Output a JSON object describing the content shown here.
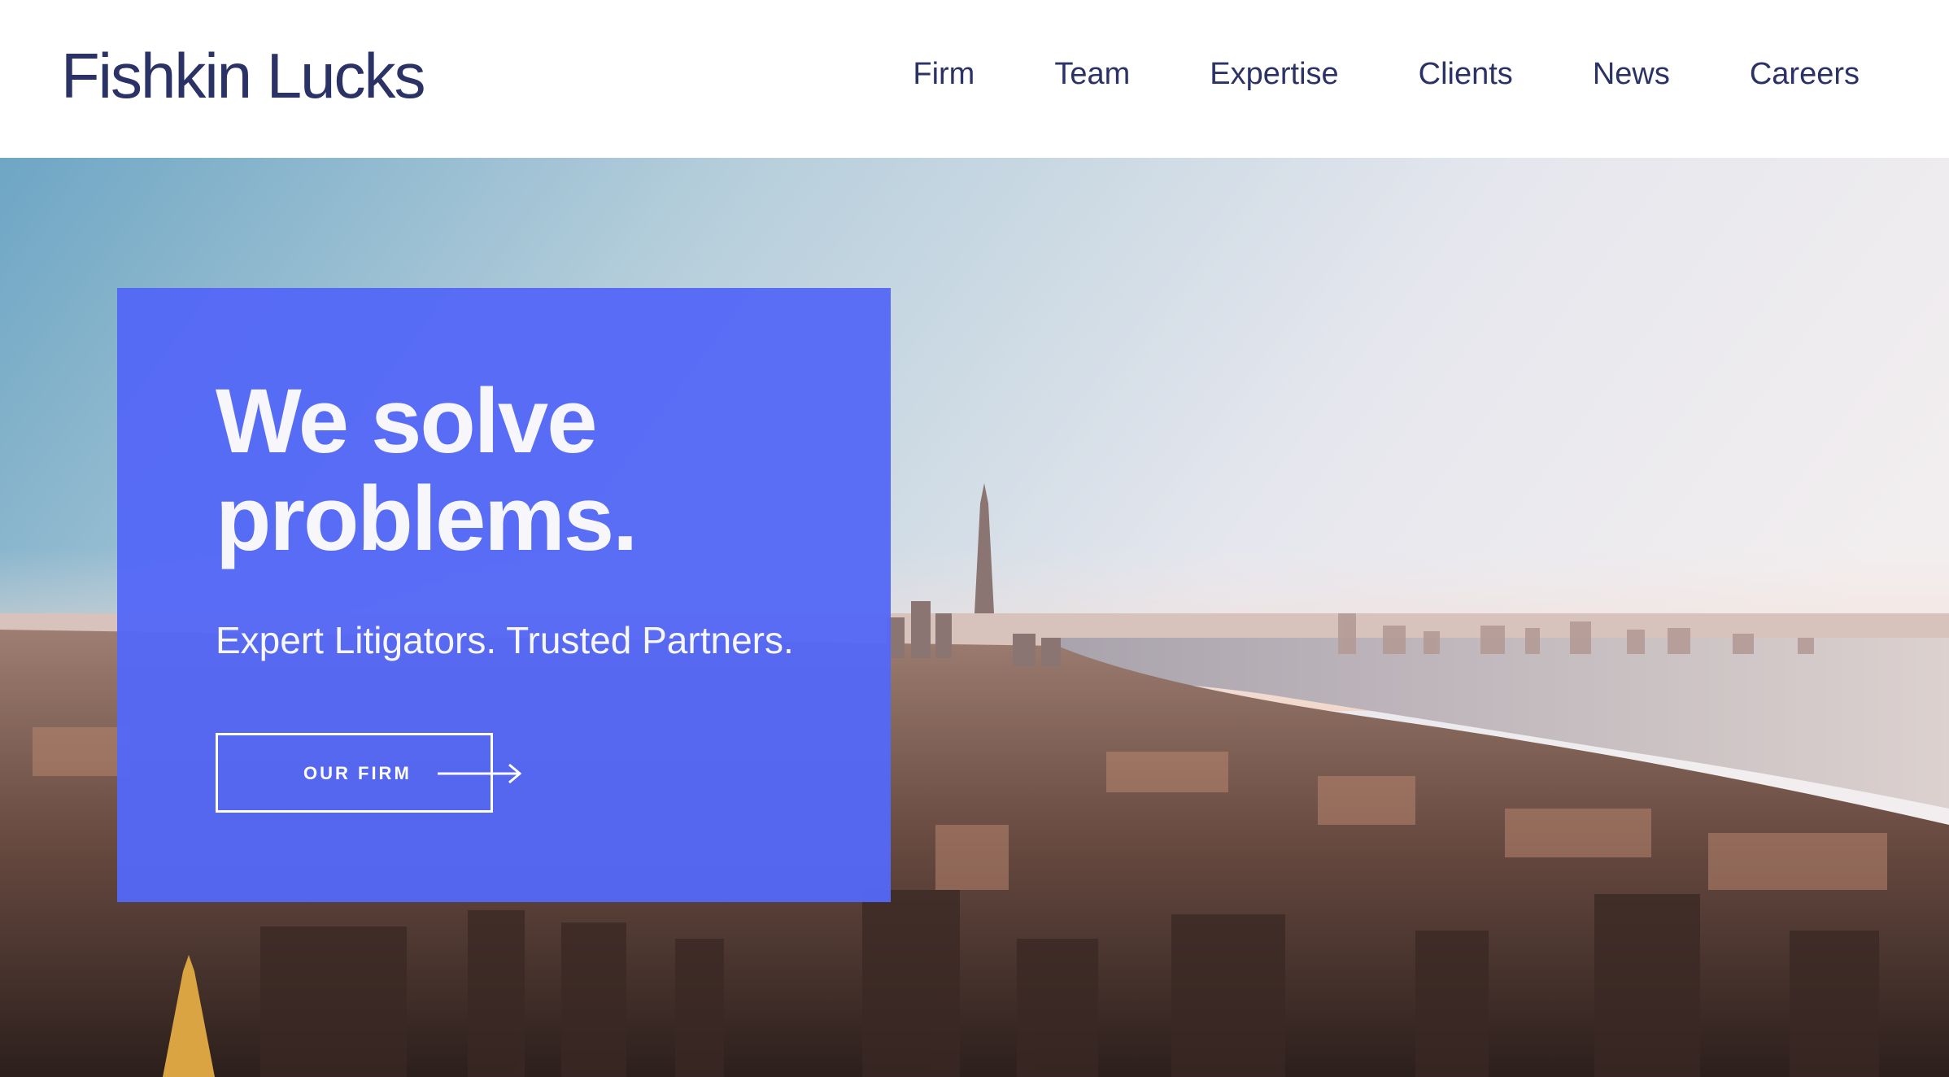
{
  "header": {
    "logo": "Fishkin Lucks",
    "nav": [
      {
        "label": "Firm"
      },
      {
        "label": "Team"
      },
      {
        "label": "Expertise"
      },
      {
        "label": "Clients"
      },
      {
        "label": "News"
      },
      {
        "label": "Careers"
      }
    ]
  },
  "hero": {
    "headline_line1": "We solve",
    "headline_line2": "problems.",
    "subhead": "Expert Litigators. Trusted Partners.",
    "cta_label": "OUR FIRM",
    "cta_icon": "arrow-right-icon",
    "background": "city-skyline-aerial-photo"
  },
  "colors": {
    "brand_navy": "#2b3266",
    "accent_blue": "#5468f6",
    "text_light": "#f7f7fb"
  }
}
